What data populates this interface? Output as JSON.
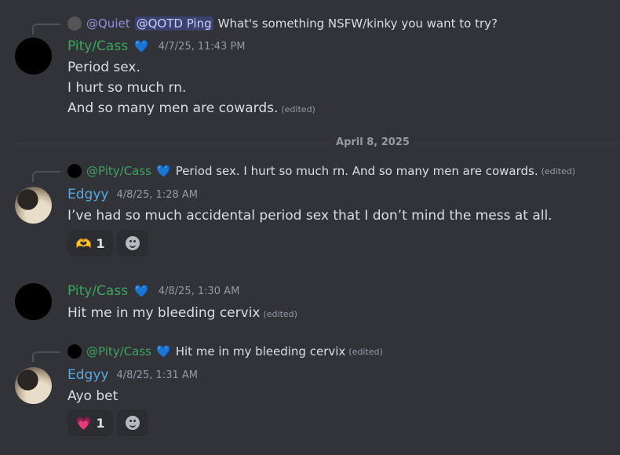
{
  "messages": [
    {
      "reply": {
        "name": "@Quiet",
        "ping": "@QOTD Ping",
        "text": "What's something NSFW/kinky you want to try?"
      },
      "author": "Pity/Cass",
      "heart": "💙",
      "time": "4/7/25, 11:43 PM",
      "lines": [
        "Period sex.",
        "I hurt so much rn.",
        "And so many men are cowards."
      ],
      "edited": "(edited)"
    },
    {
      "reply": {
        "name": "@Pity/Cass",
        "heart": "💙",
        "text": "Period sex. I hurt so much rn. And so many men are cowards.",
        "edited": "(edited)"
      },
      "author": "Edgyy",
      "time": "4/8/25, 1:28 AM",
      "lines": [
        "I’ve had so much accidental period sex that I don’t mind the mess at all."
      ],
      "reaction": {
        "emoji": "🫶",
        "count": "1"
      }
    },
    {
      "author": "Pity/Cass",
      "heart": "💙",
      "time": "4/8/25, 1:30 AM",
      "lines": [
        "Hit me in my bleeding cervix"
      ],
      "edited": "(edited)"
    },
    {
      "reply": {
        "name": "@Pity/Cass",
        "heart": "💙",
        "text": "Hit me in my bleeding cervix",
        "edited": "(edited)"
      },
      "author": "Edgyy",
      "time": "4/8/25, 1:31 AM",
      "lines": [
        "Ayo bet"
      ],
      "reaction": {
        "emoji": "💗",
        "count": "1"
      }
    }
  ],
  "divider": "April 8, 2025",
  "colors": {
    "background": "#313338",
    "green_name": "#3ba55c",
    "blue_name": "#5aa8e0"
  }
}
